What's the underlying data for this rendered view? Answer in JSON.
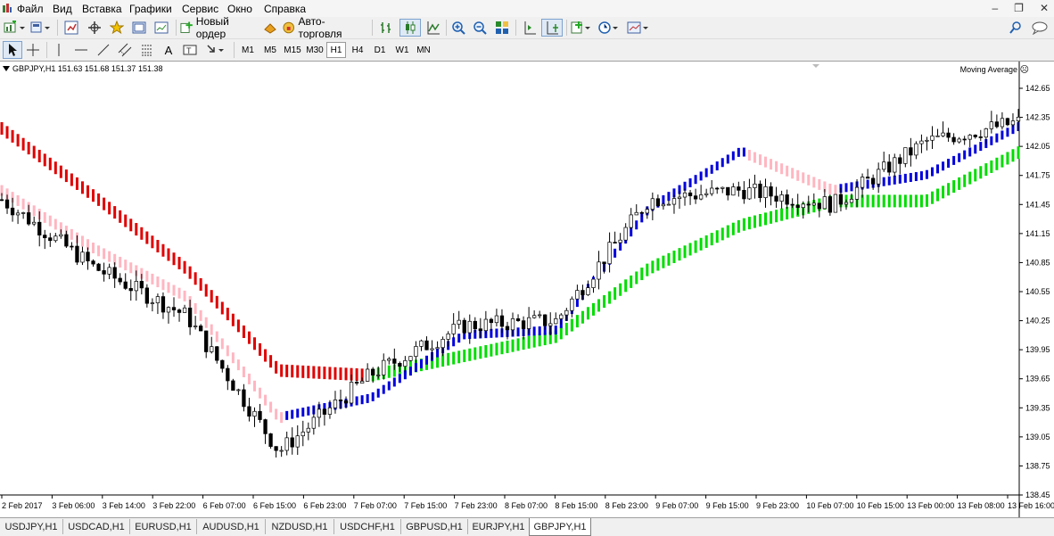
{
  "menu": [
    "Файл",
    "Вид",
    "Вставка",
    "Графики",
    "Сервис",
    "Окно",
    "Справка"
  ],
  "toolbar": {
    "new_order_label": "Новый ордер",
    "autotrading_label": "Авто-торговля"
  },
  "timeframes": [
    "M1",
    "M5",
    "M15",
    "M30",
    "H1",
    "H4",
    "D1",
    "W1",
    "MN"
  ],
  "selected_timeframe": "H1",
  "chart": {
    "symbol_info": "GBPJPY,H1  151.63 151.68 151.37 151.38",
    "indicator": "Moving Average",
    "price_axis": [
      "142.65",
      "142.35",
      "142.05",
      "141.75",
      "141.45",
      "141.15",
      "140.85",
      "140.55",
      "140.25",
      "139.95",
      "139.65",
      "139.35",
      "139.05",
      "138.75",
      "138.45"
    ],
    "time_axis": [
      "2 Feb 2017",
      "3 Feb 06:00",
      "3 Feb 14:00",
      "3 Feb 22:00",
      "6 Feb 07:00",
      "6 Feb 15:00",
      "6 Feb 23:00",
      "7 Feb 07:00",
      "7 Feb 15:00",
      "7 Feb 23:00",
      "8 Feb 07:00",
      "8 Feb 15:00",
      "8 Feb 23:00",
      "9 Feb 07:00",
      "9 Feb 15:00",
      "9 Feb 23:00",
      "10 Feb 07:00",
      "10 Feb 15:00",
      "13 Feb 00:00",
      "13 Feb 08:00",
      "13 Feb 16:00"
    ],
    "colors": {
      "bull": "#ffffff",
      "bear": "#000000",
      "ma_up_fast": "#0000dd",
      "ma_up_slow": "#00dd00",
      "ma_down_fast": "#ffb6c1",
      "ma_down_slow": "#e00000"
    }
  },
  "tabs": [
    "USDJPY,H1",
    "USDCAD,H1",
    "EURUSD,H1",
    "AUDUSD,H1",
    "NZDUSD,H1",
    "USDCHF,H1",
    "GBPUSD,H1",
    "EURJPY,H1",
    "GBPJPY,H1"
  ],
  "active_tab": "GBPJPY,H1",
  "chart_data": {
    "type": "candlestick",
    "symbol": "GBPJPY",
    "timeframe": "H1",
    "ylim": [
      138.4,
      142.7
    ],
    "anchors_time": [
      "2 Feb 2017",
      "3 Feb 14:00",
      "6 Feb 07:00",
      "7 Feb 07:00",
      "7 Feb 15:00",
      "8 Feb 07:00",
      "8 Feb 23:00",
      "9 Feb 15:00",
      "10 Feb 07:00",
      "10 Feb 15:00",
      "13 Feb 00:00",
      "13 Feb 16:00"
    ],
    "anchors_close": [
      141.5,
      140.8,
      140.3,
      138.9,
      139.7,
      140.2,
      140.25,
      141.5,
      141.6,
      141.45,
      142.1,
      142.3
    ],
    "ma_fast_anchors": [
      141.65,
      141.05,
      140.55,
      139.3,
      139.5,
      140.15,
      140.2,
      141.45,
      142.05,
      141.65,
      141.8,
      142.3
    ],
    "ma_slow_anchors": [
      142.3,
      141.6,
      140.85,
      139.8,
      139.75,
      139.95,
      140.15,
      140.85,
      141.3,
      141.55,
      141.55,
      142.05
    ]
  }
}
